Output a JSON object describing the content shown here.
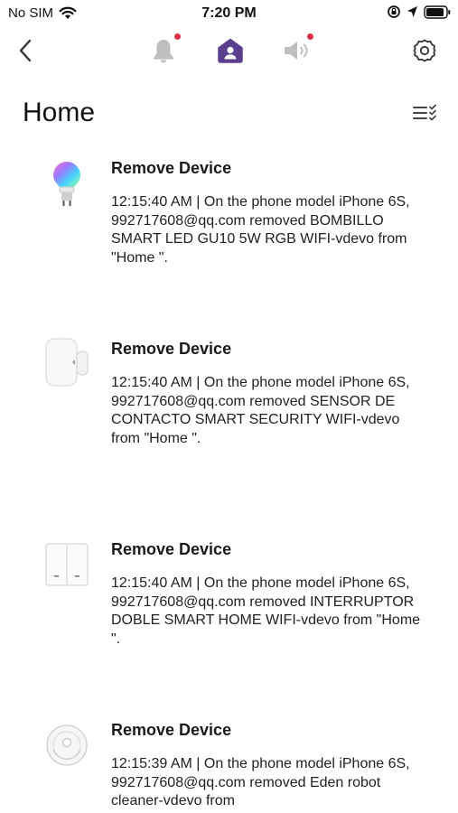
{
  "status_bar": {
    "carrier": "No SIM",
    "time": "7:20 PM"
  },
  "nav": {
    "back_icon": "chevron-left-icon",
    "tabs": [
      {
        "icon": "bell-icon",
        "active": false,
        "badge": true
      },
      {
        "icon": "home-user-icon",
        "active": true,
        "badge": false
      },
      {
        "icon": "speaker-icon",
        "active": false,
        "badge": true
      }
    ],
    "settings_icon": "gear-icon"
  },
  "page": {
    "title": "Home"
  },
  "colors": {
    "accent": "#5b3f8f",
    "badge": "#e0314b",
    "inactive_icon": "#bfbfbf"
  },
  "logs": [
    {
      "thumb": "smart-bulb-icon",
      "title": "Remove Device",
      "text": "12:15:40 AM | On the phone model iPhone 6S, 992717608@qq.com removed BOMBILLO SMART LED GU10 5W RGB WIFI-vdevo from \"Home \"."
    },
    {
      "thumb": "contact-sensor-icon",
      "title": "Remove Device",
      "text": "12:15:40 AM | On the phone model iPhone 6S, 992717608@qq.com removed SENSOR DE CONTACTO SMART SECURITY WIFI-vdevo from \"Home \"."
    },
    {
      "thumb": "double-switch-icon",
      "title": "Remove Device",
      "text": "12:15:40 AM | On the phone model iPhone 6S, 992717608@qq.com removed INTERRUPTOR DOBLE SMART HOME WIFI-vdevo from \"Home \"."
    },
    {
      "thumb": "robot-cleaner-icon",
      "title": "Remove Device",
      "text": "12:15:39 AM | On the phone model iPhone 6S, 992717608@qq.com removed Eden robot cleaner-vdevo from"
    }
  ]
}
